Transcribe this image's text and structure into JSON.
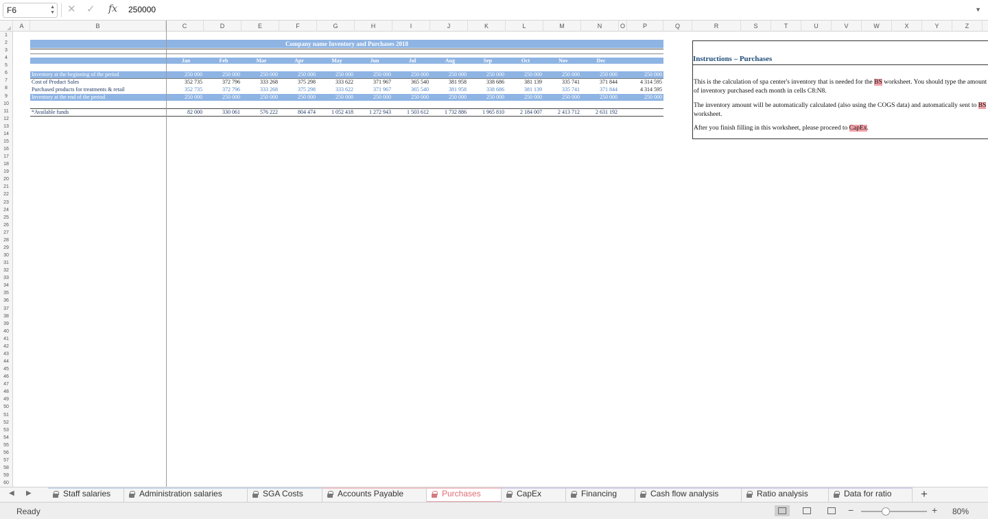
{
  "formula_bar": {
    "cell_ref": "F6",
    "fx": "fx",
    "value": "250000"
  },
  "columns": [
    "A",
    "B",
    "C",
    "D",
    "E",
    "F",
    "G",
    "H",
    "I",
    "J",
    "K",
    "L",
    "M",
    "N",
    "O",
    "P",
    "Q",
    "R",
    "S",
    "T",
    "U",
    "V",
    "W",
    "X",
    "Y",
    "Z"
  ],
  "rows": [
    "1",
    "2",
    "3",
    "4",
    "5",
    "6",
    "7",
    "8",
    "9",
    "10",
    "11",
    "12",
    "13",
    "14",
    "15",
    "16",
    "17",
    "18",
    "19",
    "20",
    "21",
    "22",
    "23",
    "24",
    "25",
    "26",
    "27",
    "28",
    "29",
    "30",
    "31",
    "32",
    "33",
    "34",
    "35",
    "36",
    "37",
    "38",
    "39",
    "40",
    "41",
    "42",
    "43",
    "44",
    "45",
    "46",
    "47",
    "48",
    "49",
    "50",
    "51",
    "52",
    "53",
    "54",
    "55",
    "56",
    "57",
    "58",
    "59",
    "60"
  ],
  "sheet": {
    "title": "Company name Inventory and Purchases 2018",
    "months": [
      "Jan",
      "Feb",
      "Mar",
      "Apr",
      "May",
      "Jun",
      "Jul",
      "Aug",
      "Sep",
      "Oct",
      "Nov",
      "Dec"
    ],
    "table_rows": [
      {
        "label": "Inventory at the beginning of the period",
        "values": [
          "250 000",
          "250 000",
          "250 000",
          "250 000",
          "250 000",
          "250 000",
          "250 000",
          "250 000",
          "250 000",
          "250 000",
          "250 000",
          "250 000"
        ],
        "total": "250 000"
      },
      {
        "label": "Cost of Product Sales",
        "values": [
          "352 735",
          "372 796",
          "333 268",
          "375 298",
          "333 622",
          "371 967",
          "365 540",
          "381 958",
          "338 686",
          "381 139",
          "335 741",
          "371 844"
        ],
        "total": "4 314 595"
      },
      {
        "label": "Purchased products for treatments & retail",
        "values": [
          "352 735",
          "372 796",
          "333 268",
          "375 298",
          "333 622",
          "371 967",
          "365 540",
          "381 958",
          "338 686",
          "381 139",
          "335 741",
          "371 844"
        ],
        "total": "4 314 595"
      },
      {
        "label": "Inventory at the end of the period",
        "values": [
          "250 000",
          "250 000",
          "250 000",
          "250 000",
          "250 000",
          "250 000",
          "250 000",
          "250 000",
          "250 000",
          "250 000",
          "250 000",
          "250 000"
        ],
        "total": "250 000"
      }
    ],
    "available_funds": {
      "label": "*Available funds",
      "values": [
        "82 000",
        "330 061",
        "576 222",
        "804 474",
        "1 052 418",
        "1 272 943",
        "1 503 612",
        "1 732 886",
        "1 965 810",
        "2 184 007",
        "2 413 712",
        "2 631 192"
      ]
    }
  },
  "instructions": {
    "title": "Instructions – Purchases",
    "p1_a": "This is the calculation of spa center's inventory that is needed for the ",
    "p1_hl": "BS",
    "p1_b": " worksheet. You should type the amount of inventory purchased each month in cells C8:N8.",
    "p2_a": "The inventory amount will be automatically calculated (also using the COGS data) and automatically sent to ",
    "p2_hl": "BS",
    "p2_b": " worksheet.",
    "p3_a": "After you finish filling in this worksheet, please proceed to ",
    "p3_hl": "CapEx",
    "p3_b": "."
  },
  "tabs": [
    {
      "label": "Staff salaries",
      "stripe": "#c8d7ee"
    },
    {
      "label": "Administration salaries",
      "stripe": "#c8d7ee"
    },
    {
      "label": "SGA Costs",
      "stripe": "#c8d7ee"
    },
    {
      "label": "Accounts Payable",
      "stripe": "#f1c6cb"
    },
    {
      "label": "Purchases",
      "stripe": "#f1c6cb"
    },
    {
      "label": "CapEx",
      "stripe": "#d7d0ec"
    },
    {
      "label": "Financing",
      "stripe": "#d7d0ec"
    },
    {
      "label": "Cash flow analysis",
      "stripe": "#d7d0ec"
    },
    {
      "label": "Ratio analysis",
      "stripe": "#d7d0ec"
    },
    {
      "label": "Data for ratio",
      "stripe": "#d7d0ec"
    }
  ],
  "active_tab": "Purchases",
  "status": {
    "text": "Ready",
    "zoom": "80%",
    "zoom_fraction": 0.38
  },
  "colors": {
    "band": "#8eb4e3",
    "header_text": "#ffffff",
    "input_blue": "#4a7fc1",
    "label_dark": "#1f3864",
    "highlight": "#f2a1a8",
    "active_tab": "#e06c75"
  }
}
